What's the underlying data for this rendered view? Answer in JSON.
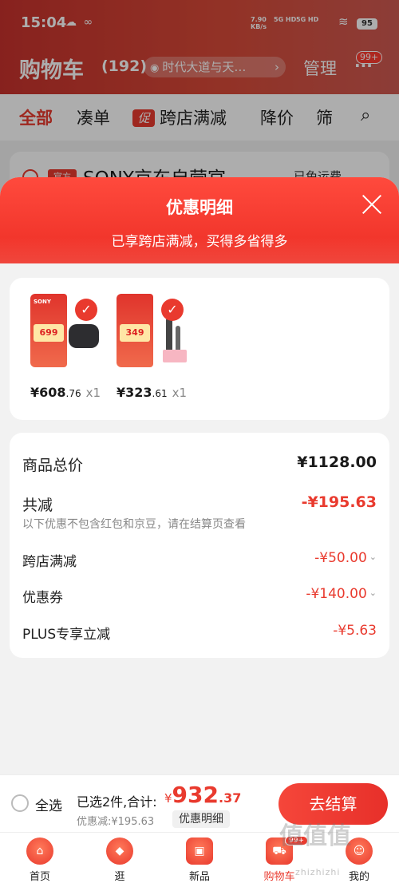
{
  "status_bar": {
    "time": "15:04",
    "app_icons": "☁ ∞",
    "net_speed_value": "7.90",
    "net_speed_unit": "KB/s",
    "signal1": "5G HD",
    "signal2": "5G HD",
    "battery": "95"
  },
  "header": {
    "title": "购物车",
    "count": "(192)",
    "location": "时代大道与天…",
    "manage_label": "管理",
    "more_badge": "99+"
  },
  "tabs": [
    {
      "label": "全部"
    },
    {
      "label": "凑单"
    },
    {
      "label": "跨店满减",
      "promo_tag": "促"
    },
    {
      "label": "降价"
    },
    {
      "label": "筛"
    }
  ],
  "peek_store": {
    "tag": "官方",
    "name": "SONY京东自营官",
    "shipping": "已免运费"
  },
  "sheet": {
    "title": "优惠明细",
    "subtitle": "已享跨店满减，买得多省得多"
  },
  "products": [
    {
      "price_int": "¥608",
      "price_dec": ".76",
      "qty": "x1",
      "promo_brand": "SONY",
      "promo_price": "699"
    },
    {
      "price_int": "¥323",
      "price_dec": ".61",
      "qty": "x1",
      "promo_brand": "",
      "promo_price": "349"
    }
  ],
  "summary": {
    "total_label": "商品总价",
    "total_value": "¥1128.00",
    "reduce_label": "共减",
    "reduce_value": "-¥195.63",
    "reduce_note": "以下优惠不包含红包和京豆，请在结算页查看",
    "lines": [
      {
        "label": "跨店满减",
        "value": "-¥50.00"
      },
      {
        "label": "优惠券",
        "value": "-¥140.00"
      },
      {
        "label": "PLUS专享立减",
        "value": "-¥5.63"
      }
    ]
  },
  "checkout": {
    "select_all": "全选",
    "selected_text": "已选2件,合计:",
    "total_cur": "¥",
    "total_int": "932",
    "total_dec": ".37",
    "discount_text": "优惠减:¥195.63",
    "detail_btn": "优惠明细",
    "go_btn": "去结算"
  },
  "nav": [
    {
      "label": "首页",
      "icon": "home-icon"
    },
    {
      "label": "逛",
      "icon": "explore-icon"
    },
    {
      "label": "新品",
      "icon": "new-icon"
    },
    {
      "label": "购物车",
      "icon": "cart-icon",
      "badge": "99+"
    },
    {
      "label": "我的",
      "icon": "profile-icon"
    }
  ],
  "watermark": {
    "big": "值值值",
    "small": "zhizhizhi"
  }
}
